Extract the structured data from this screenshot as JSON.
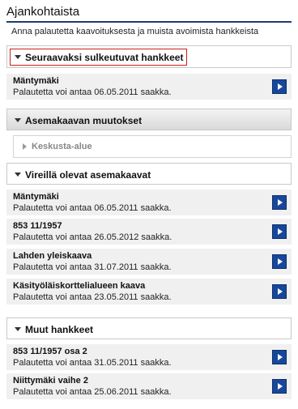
{
  "page": {
    "title": "Ajankohtaista",
    "intro": "Anna palautetta kaavoituksesta ja muista avoimista hankkeista"
  },
  "sections": {
    "closing": {
      "label": "Seuraavaksi sulkeutuvat hankkeet",
      "items": [
        {
          "name": "Mäntymäki",
          "feedback": "Palautetta voi antaa 06.05.2011 saakka."
        }
      ]
    },
    "changes": {
      "label": "Asemakaavan muutokset",
      "sub_label": "Keskusta-alue"
    },
    "pending": {
      "label": "Vireillä olevat asemakaavat",
      "items": [
        {
          "name": "Mäntymäki",
          "feedback": "Palautetta voi antaa 06.05.2011 saakka."
        },
        {
          "name": "853 11/1957",
          "feedback": "Palautetta voi antaa 26.05.2012 saakka."
        },
        {
          "name": "Lahden yleiskaava",
          "feedback": "Palautetta voi antaa 31.07.2011 saakka."
        },
        {
          "name": "Käsityöläiskorttelialueen kaava",
          "feedback": "Palautetta voi antaa 23.05.2011 saakka."
        }
      ]
    },
    "other": {
      "label": "Muut hankkeet",
      "items": [
        {
          "name": "853 11/1957 osa 2",
          "feedback": "Palautetta voi antaa 31.05.2011 saakka."
        },
        {
          "name": "Niittymäki vaihe 2",
          "feedback": "Palautetta voi antaa 25.06.2011 saakka."
        }
      ]
    }
  },
  "colors": {
    "accent": "#16479b",
    "highlight": "#cc1d1d",
    "row_bg": "#f0f0f0"
  },
  "icons": {
    "expanded": "triangle-down-icon",
    "collapsed": "triangle-right-icon",
    "go": "arrow-right-icon"
  }
}
